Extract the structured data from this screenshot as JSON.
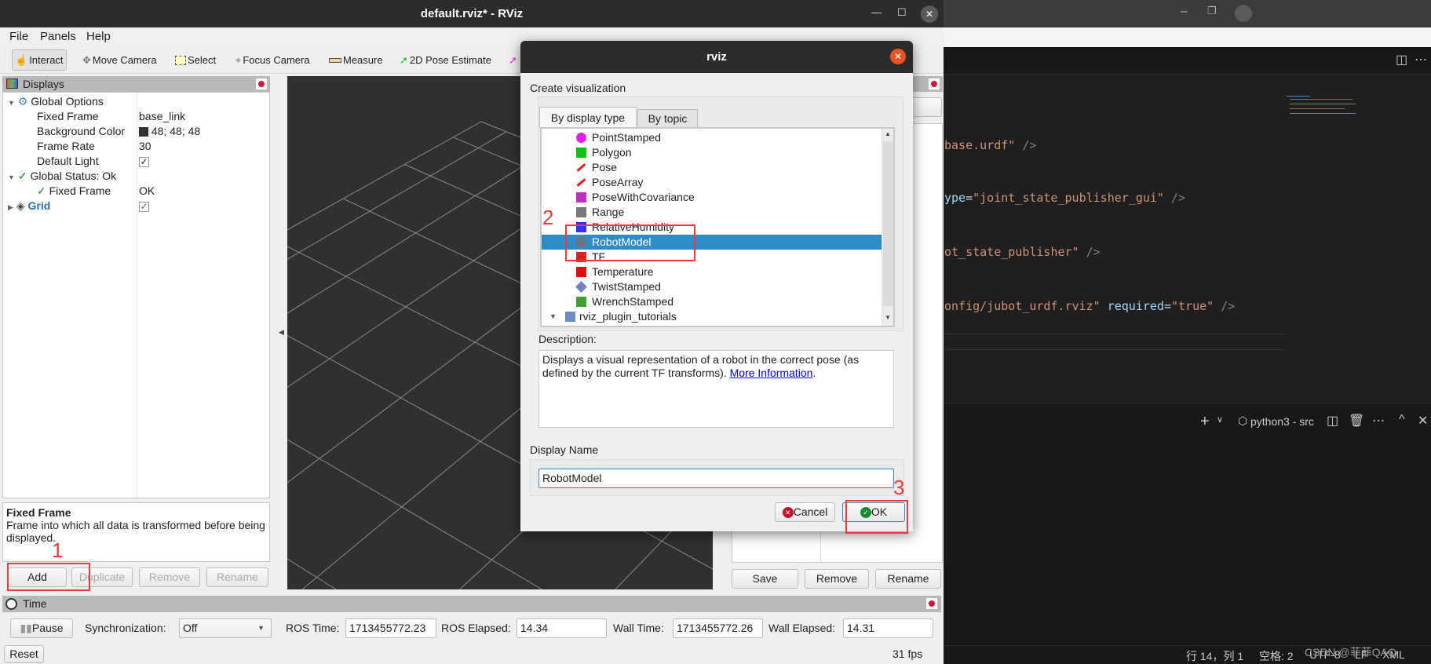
{
  "rviz": {
    "title": "default.rviz* - RViz",
    "menu": [
      "File",
      "Panels",
      "Help"
    ],
    "toolbar": [
      "Interact",
      "Move Camera",
      "Select",
      "Focus Camera",
      "Measure",
      "2D Pose Estimate"
    ],
    "displays": {
      "title": "Displays",
      "rows": [
        {
          "name": "Global Options",
          "value": ""
        },
        {
          "name": "Fixed Frame",
          "value": "base_link"
        },
        {
          "name": "Background Color",
          "value": "48; 48; 48"
        },
        {
          "name": "Frame Rate",
          "value": "30"
        },
        {
          "name": "Default Light",
          "value": "checked"
        },
        {
          "name": "Global Status: Ok",
          "value": ""
        },
        {
          "name": "Fixed Frame",
          "value": "OK"
        },
        {
          "name": "Grid",
          "value": "checked"
        }
      ],
      "background_color": "#303030",
      "help_title": "Fixed Frame",
      "help_text": "Frame into which all data is transformed before being displayed.",
      "buttons": {
        "add": "Add",
        "duplicate": "Duplicate",
        "remove": "Remove",
        "rename": "Rename"
      }
    },
    "views": {
      "partial_button": "ro",
      "buttons": {
        "save": "Save",
        "remove": "Remove",
        "rename": "Rename"
      }
    },
    "time": {
      "title": "Time",
      "pause": "Pause",
      "sync_label": "Synchronization:",
      "sync_value": "Off",
      "ros_time_label": "ROS Time:",
      "ros_time": "1713455772.23",
      "ros_elapsed_label": "ROS Elapsed:",
      "ros_elapsed": "14.34",
      "wall_time_label": "Wall Time:",
      "wall_time": "1713455772.26",
      "wall_elapsed_label": "Wall Elapsed:",
      "wall_elapsed": "14.31",
      "reset": "Reset",
      "fps": "31 fps"
    }
  },
  "dialog": {
    "title": "rviz",
    "create_label": "Create visualization",
    "tabs": [
      "By display type",
      "By topic"
    ],
    "items": [
      {
        "label": "PointStamped",
        "icon": "point-icon",
        "color": "#e020e0"
      },
      {
        "label": "Polygon",
        "icon": "polygon-icon",
        "color": "#10c010"
      },
      {
        "label": "Pose",
        "icon": "pose-arrow-icon",
        "color": "#e02020"
      },
      {
        "label": "PoseArray",
        "icon": "pose-array-icon",
        "color": "#e02020"
      },
      {
        "label": "PoseWithCovariance",
        "icon": "pose-covariance-icon",
        "color": "#c030c0"
      },
      {
        "label": "Range",
        "icon": "range-cone-icon",
        "color": "#777777"
      },
      {
        "label": "RelativeHumidity",
        "icon": "humidity-icon",
        "color": "#3030ff"
      },
      {
        "label": "RobotModel",
        "icon": "robot-icon",
        "color": "#667788",
        "selected": true
      },
      {
        "label": "TF",
        "icon": "tf-axes-icon",
        "color": "#e02020"
      },
      {
        "label": "Temperature",
        "icon": "thermometer-icon",
        "color": "#dd1111"
      },
      {
        "label": "TwistStamped",
        "icon": "twist-diamond-icon",
        "color": "#7080c0"
      },
      {
        "label": "WrenchStamped",
        "icon": "wrench-icon",
        "color": "#40a030"
      },
      {
        "label": "rviz_plugin_tutorials",
        "icon": "folder-icon",
        "color": "#6a8cc0"
      }
    ],
    "description_label": "Description:",
    "description": "Displays a visual representation of a robot in the correct pose (as defined by the current TF transforms). ",
    "description_link": "More Information",
    "description_end": ".",
    "display_name_label": "Display Name",
    "display_name": "RobotModel",
    "cancel": "Cancel",
    "ok": "OK"
  },
  "annotations": [
    "1",
    "2",
    "3"
  ],
  "vscode": {
    "code": [
      {
        "parts": [
          [
            "s",
            "base.urdf\""
          ],
          [
            "p",
            " />"
          ]
        ]
      },
      {
        "parts": [
          [
            "a",
            "ype"
          ],
          [
            "e",
            "="
          ],
          [
            "s",
            "\"joint_state_publisher_gui\""
          ],
          [
            "p",
            " />"
          ]
        ]
      },
      {
        "parts": [
          [
            "s",
            "ot_state_publisher\""
          ],
          [
            "p",
            " />"
          ]
        ]
      },
      {
        "parts": [
          [
            "s",
            "onfig/jubot_urdf.rviz\""
          ],
          [
            "e",
            " "
          ],
          [
            "a",
            "required"
          ],
          [
            "e",
            "="
          ],
          [
            "s",
            "\"true\""
          ],
          [
            "p",
            " />"
          ]
        ]
      }
    ],
    "terminal_name": "python3 - src",
    "status": [
      "行 14，列 1",
      "空格: 2",
      "UTF-8",
      "LF",
      "XML"
    ],
    "watermark": "CSDN @菲菲QAQ"
  }
}
